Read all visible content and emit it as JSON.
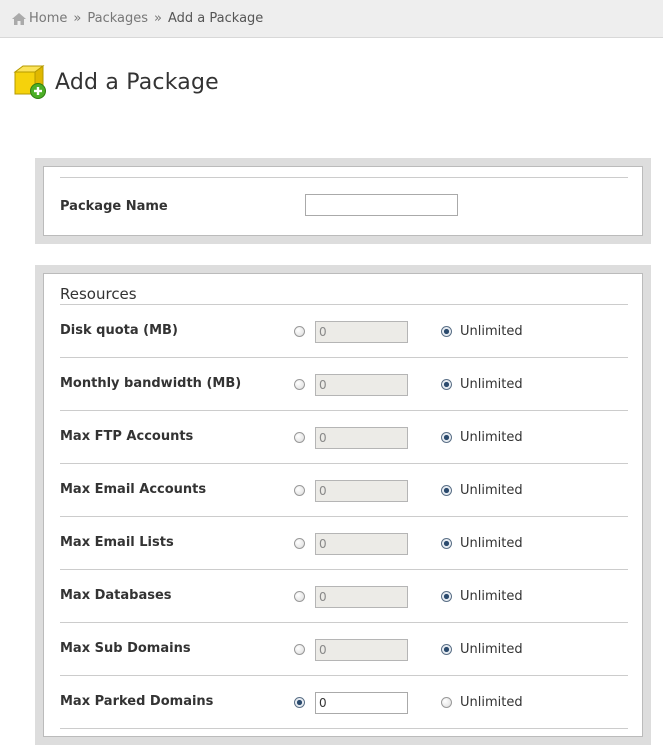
{
  "breadcrumb": {
    "home": "Home",
    "separator": "»",
    "packages": "Packages",
    "current": "Add a Package"
  },
  "page": {
    "title": "Add a Package",
    "icon": "package-add-icon"
  },
  "package_name": {
    "label": "Package Name",
    "value": ""
  },
  "resources": {
    "title": "Resources",
    "unlimited_label": "Unlimited",
    "rows": [
      {
        "label": "Disk quota (MB)",
        "value": "0",
        "mode": "unlimited"
      },
      {
        "label": "Monthly bandwidth (MB)",
        "value": "0",
        "mode": "unlimited"
      },
      {
        "label": "Max FTP Accounts",
        "value": "0",
        "mode": "unlimited"
      },
      {
        "label": "Max Email Accounts",
        "value": "0",
        "mode": "unlimited"
      },
      {
        "label": "Max Email Lists",
        "value": "0",
        "mode": "unlimited"
      },
      {
        "label": "Max Databases",
        "value": "0",
        "mode": "unlimited"
      },
      {
        "label": "Max Sub Domains",
        "value": "0",
        "mode": "unlimited"
      },
      {
        "label": "Max Parked Domains",
        "value": "0",
        "mode": "limited"
      }
    ]
  },
  "colors": {
    "breadcrumb_bg": "#eeeeee",
    "panel_bg": "#dddddd",
    "disabled_input_bg": "#ecebe7",
    "radio_checked": "#2b4a6d",
    "icon_yellow": "#f5d20c",
    "icon_green": "#4caf26"
  }
}
